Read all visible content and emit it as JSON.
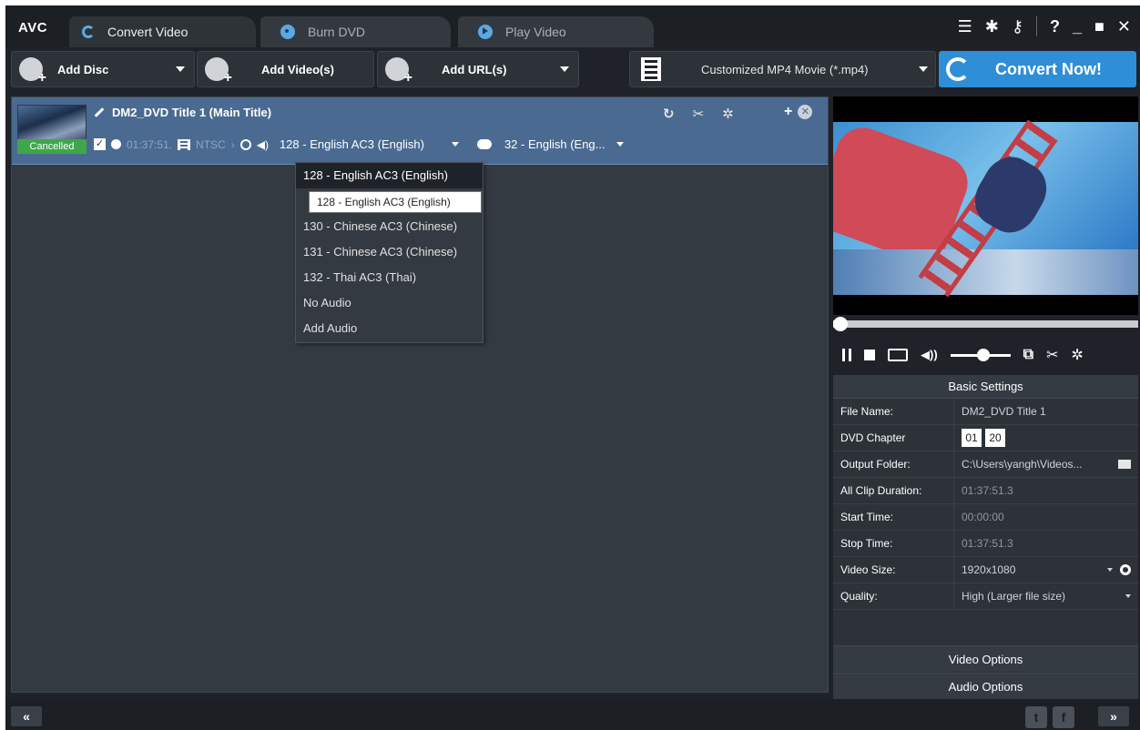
{
  "app": {
    "logo": "AVC"
  },
  "tabs": [
    {
      "label": "Convert Video",
      "icon": "refresh-icon",
      "active": true
    },
    {
      "label": "Burn DVD",
      "icon": "dvd-icon",
      "active": false
    },
    {
      "label": "Play Video",
      "icon": "play-icon",
      "active": false
    }
  ],
  "window_controls": [
    "menu-icon",
    "gear-icon",
    "key-icon",
    "help-icon",
    "minimize-icon",
    "maximize-icon",
    "close-icon"
  ],
  "toolbar": {
    "add_disc": "Add Disc",
    "add_videos": "Add Video(s)",
    "add_url": "Add URL(s)",
    "profile": "Customized MP4 Movie (*.mp4)",
    "convert_now": "Convert Now!"
  },
  "file": {
    "title": "DM2_DVD Title 1 (Main Title)",
    "status": "Cancelled",
    "checked": true,
    "duration": "01:37:51.",
    "video_standard": "NTSC",
    "audio_track": "128 - English AC3 (English)",
    "subtitle": "32 - English (Eng..."
  },
  "audio_dropdown": {
    "items": [
      "128 - English AC3 (English)",
      "",
      "130 - Chinese AC3 (Chinese)",
      "131 - Chinese AC3 (Chinese)",
      "132 - Thai AC3 (Thai)",
      "No Audio",
      "Add Audio"
    ],
    "selected_index": 0,
    "tooltip": "128 - English AC3 (English)"
  },
  "player": {
    "volume_level": 0.55,
    "seek_position": 0.0
  },
  "settings": {
    "header": "Basic Settings",
    "rows": {
      "file_name_label": "File Name:",
      "file_name": "DM2_DVD Title 1",
      "dvd_chapter_label": "DVD Chapter",
      "chapter_start": "01",
      "chapter_end": "20",
      "output_folder_label": "Output Folder:",
      "output_folder": "C:\\Users\\yangh\\Videos...",
      "all_clip_duration_label": "All Clip Duration:",
      "all_clip_duration": "01:37:51.3",
      "start_time_label": "Start Time:",
      "start_time": "00:00:00",
      "stop_time_label": "Stop Time:",
      "stop_time": "01:37:51.3",
      "video_size_label": "Video Size:",
      "video_size": "1920x1080",
      "quality_label": "Quality:",
      "quality": "High (Larger file size)"
    },
    "video_options": "Video Options",
    "audio_options": "Audio Options"
  },
  "bottom": {
    "collapse_left": "«",
    "collapse_right": "»"
  },
  "colors": {
    "accent": "#2e8ed6",
    "selected_row": "#4a6a92",
    "status_green": "#3fa64a"
  }
}
